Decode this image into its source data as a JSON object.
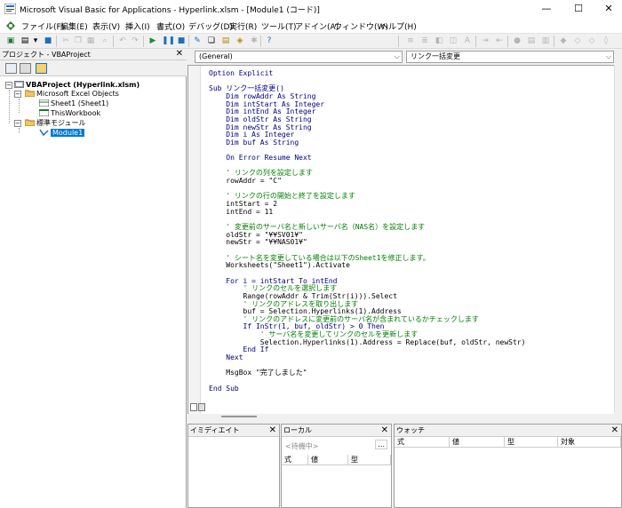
{
  "window": {
    "title": "Microsoft Visual Basic for Applications - Hyperlink.xlsm - [Module1 (コード)]",
    "buttons": [
      "—",
      "☐",
      "✕"
    ]
  },
  "menu": [
    "ファイル(F)",
    "編集(E)",
    "表示(V)",
    "挿入(I)",
    "書式(O)",
    "デバッグ(D)",
    "実行(R)",
    "ツール(T)",
    "アドイン(A)",
    "ウィンドウ(W)",
    "ヘルプ(H)"
  ],
  "project": {
    "header": "プロジェクト - VBAProject",
    "close": "✕",
    "tree": {
      "root": "VBAProject (Hyperlink.xlsm)",
      "excel_objects": "Microsoft Excel Objects",
      "sheet1": "Sheet1 (Sheet1)",
      "workbook": "ThisWorkbook",
      "std_modules": "標準モジュール",
      "module1": "Module1"
    }
  },
  "code": {
    "object_combo": "(General)",
    "proc_combo": "リンク一括変更",
    "lines": [
      {
        "t": "Option Explicit",
        "c": "kw"
      },
      {
        "t": "",
        "c": "tx"
      },
      {
        "t": "Sub リンク一括変更()",
        "c": "kw"
      },
      {
        "t": "    Dim rowAddr As String",
        "c": "kw"
      },
      {
        "t": "    Dim intStart As Integer",
        "c": "kw"
      },
      {
        "t": "    Dim intEnd As Integer",
        "c": "kw"
      },
      {
        "t": "    Dim oldStr As String",
        "c": "kw"
      },
      {
        "t": "    Dim newStr As String",
        "c": "kw"
      },
      {
        "t": "    Dim i As Integer",
        "c": "kw"
      },
      {
        "t": "    Dim buf As String",
        "c": "kw"
      },
      {
        "t": "",
        "c": "tx"
      },
      {
        "t": "    On Error Resume Next",
        "c": "kw"
      },
      {
        "t": "",
        "c": "tx"
      },
      {
        "t": "    ' リンクの列を設定します",
        "c": "cm"
      },
      {
        "t": "    rowAddr = \"C\"",
        "c": "tx"
      },
      {
        "t": "",
        "c": "tx"
      },
      {
        "t": "    ' リンクの行の開始と終了を設定します",
        "c": "cm"
      },
      {
        "t": "    intStart = 2",
        "c": "tx"
      },
      {
        "t": "    intEnd = 11",
        "c": "tx"
      },
      {
        "t": "",
        "c": "tx"
      },
      {
        "t": "    ' 変更前のサーバ名と新しいサーバ名（NAS名）を設定します",
        "c": "cm"
      },
      {
        "t": "    oldStr = \"¥¥SV01¥\"",
        "c": "tx"
      },
      {
        "t": "    newStr = \"¥¥NAS01¥\"",
        "c": "tx"
      },
      {
        "t": "",
        "c": "tx"
      },
      {
        "t": "    ' シート名を変更している場合は以下のSheet1を修正します。",
        "c": "cm"
      },
      {
        "t": "    Worksheets(\"Sheet1\").Activate",
        "c": "tx"
      },
      {
        "t": "",
        "c": "tx"
      },
      {
        "t": "    For i = intStart To intEnd",
        "c": "kw"
      },
      {
        "t": "        ' リンクのセルを選択します",
        "c": "cm"
      },
      {
        "t": "        Range(rowAddr & Trim(Str(i))).Select",
        "c": "tx"
      },
      {
        "t": "        ' リンクのアドレスを取り出します",
        "c": "cm"
      },
      {
        "t": "        buf = Selection.Hyperlinks(1).Address",
        "c": "tx"
      },
      {
        "t": "        ' リンクのアドレスに変更前のサーバ名が含まれているかチェックします",
        "c": "cm"
      },
      {
        "t": "        If InStr(1, buf, oldStr) > 0 Then",
        "c": "kw"
      },
      {
        "t": "            ' サーバ名を変更してリンクのセルを更新します",
        "c": "cm"
      },
      {
        "t": "            Selection.Hyperlinks(1).Address = Replace(buf, oldStr, newStr)",
        "c": "tx"
      },
      {
        "t": "        End If",
        "c": "kw"
      },
      {
        "t": "    Next",
        "c": "kw"
      },
      {
        "t": "",
        "c": "tx"
      },
      {
        "t": "    MsgBox \"完了しました\"",
        "c": "tx"
      },
      {
        "t": "",
        "c": "tx"
      },
      {
        "t": "End Sub",
        "c": "kw"
      }
    ]
  },
  "immediate": {
    "header": "イミディエイト",
    "close": "✕"
  },
  "locals": {
    "header": "ローカル",
    "close": "✕",
    "status": "<待機中>",
    "more": "...",
    "cols": [
      "式",
      "値",
      "型"
    ]
  },
  "watch": {
    "header": "ウォッチ",
    "close": "✕",
    "cols": [
      "式",
      "値",
      "型",
      "対象"
    ]
  },
  "colors": {
    "keyword": "#000080",
    "comment": "#008000",
    "selection": "#0078d7"
  }
}
